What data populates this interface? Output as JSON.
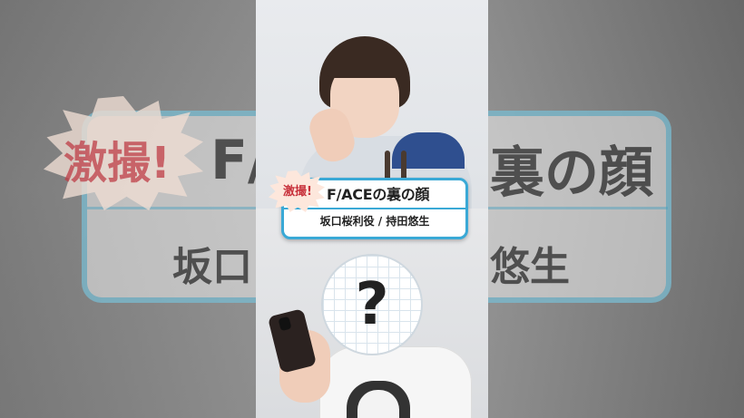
{
  "banner": {
    "badge": "激撮!",
    "title": "F/ACEの裏の顔",
    "subtitle": "坂口桜利役 / 持田悠生"
  },
  "background": {
    "badge": "激撮!",
    "title_left": "F/",
    "title_right": "裏の顔",
    "subtitle_left": "坂口",
    "subtitle_right": "悠生"
  },
  "mystery": {
    "mark": "?"
  }
}
